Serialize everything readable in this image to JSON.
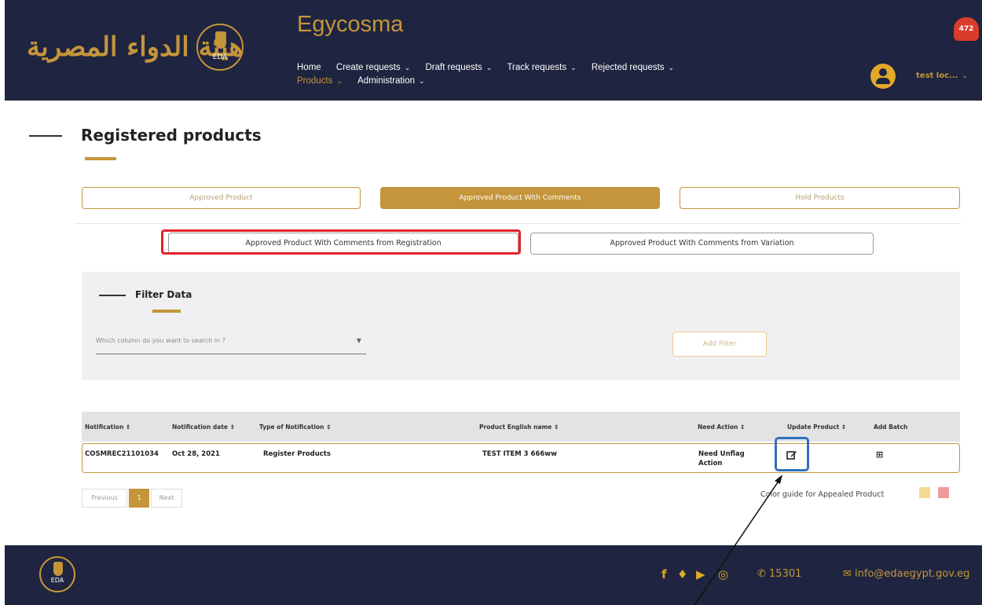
{
  "header": {
    "logo_arabic_text": "هيئة الدواء المصرية",
    "seal_text": "EDA",
    "app_title": "Egycosma",
    "notification_count": "472",
    "user_name": "test loc...",
    "nav_row1": [
      {
        "label": "Home",
        "has_dropdown": false
      },
      {
        "label": "Create requests",
        "has_dropdown": true
      },
      {
        "label": "Draft requests",
        "has_dropdown": true
      },
      {
        "label": "Track requests",
        "has_dropdown": true
      },
      {
        "label": "Rejected requests",
        "has_dropdown": true
      }
    ],
    "nav_row2": [
      {
        "label": "Products",
        "has_dropdown": true,
        "active": true
      },
      {
        "label": "Administration",
        "has_dropdown": true
      }
    ],
    "chevron": "⌄"
  },
  "page": {
    "title": "Registered products"
  },
  "tabs": [
    {
      "label": "Approved Product"
    },
    {
      "label": "Approved Product With Comments",
      "active": true
    },
    {
      "label": "Hold Products"
    }
  ],
  "subtabs": [
    {
      "label": "Approved Product With Comments from Registration",
      "highlighted": true
    },
    {
      "label": "Approved Product With Comments from Variation"
    }
  ],
  "filter": {
    "title": "Filter Data",
    "select_placeholder": "Which column do you want to search in ?",
    "add_filter_label": "Add Filter"
  },
  "table": {
    "columns": [
      "Notification ⇕",
      "Notification date ⇕",
      "Type of Notification ⇕",
      "Product English name ⇕",
      "Need Action ⇕",
      "Update Product ⇕",
      "Add Batch"
    ],
    "rows": [
      {
        "notification": "COSMREC21101034",
        "date": "Oct 28, 2021",
        "type": "Register Products",
        "product_name": "TEST ITEM 3 666ww",
        "need_action": "Need Unflag Action",
        "update_icon": "edit-icon",
        "batch_icon": "batch-icon"
      }
    ]
  },
  "pagination": {
    "previous": "Previous",
    "current": "1",
    "next": "Next"
  },
  "color_guide": {
    "label": "Color guide for Appealed Product",
    "swatches": [
      "#f6d991",
      "#ef9a9a"
    ]
  },
  "footer": {
    "seal_text": "EDA",
    "social_icons": [
      "facebook-icon",
      "twitter-icon",
      "youtube-icon",
      "instagram-icon"
    ],
    "phone": "15301",
    "email": "info@edaegypt.gov.eg"
  },
  "colors": {
    "header_bg": "#1f2540",
    "accent_gold": "#c4953a",
    "highlight_red": "#e3232a",
    "highlight_blue": "#2f6fbf"
  }
}
